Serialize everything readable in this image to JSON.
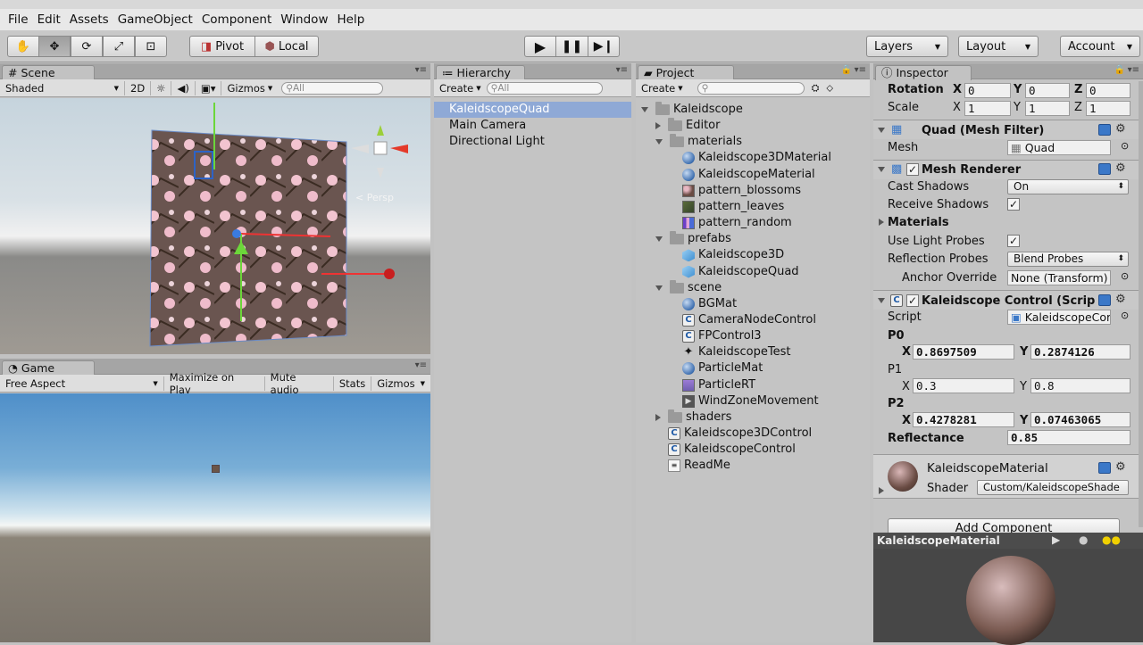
{
  "menu": [
    "File",
    "Edit",
    "Assets",
    "GameObject",
    "Component",
    "Window",
    "Help"
  ],
  "toolbar": {
    "pivot": "Pivot",
    "local": "Local",
    "layers": "Layers",
    "layout": "Layout",
    "account": "Account"
  },
  "scene": {
    "tab": "Scene",
    "shading": "Shaded",
    "mode2d": "2D",
    "gizmos": "Gizmos",
    "search_placeholder": "All",
    "persp": "< Persp"
  },
  "game": {
    "tab": "Game",
    "aspect": "Free Aspect",
    "maximize": "Maximize on Play",
    "mute": "Mute audio",
    "stats": "Stats",
    "gizmos": "Gizmos"
  },
  "hierarchy": {
    "tab": "Hierarchy",
    "create": "Create",
    "search_placeholder": "All",
    "items": [
      "KaleidscopeQuad",
      "Main Camera",
      "Directional Light"
    ]
  },
  "project": {
    "tab": "Project",
    "create": "Create",
    "items": [
      {
        "label": "Kaleidscope",
        "indent": 0,
        "icon": "folder-icon",
        "arrow": "down"
      },
      {
        "label": "Editor",
        "indent": 1,
        "icon": "folder-icon",
        "arrow": "right"
      },
      {
        "label": "materials",
        "indent": 1,
        "icon": "folder-icon",
        "arrow": "down"
      },
      {
        "label": "Kaleidscope3DMaterial",
        "indent": 2,
        "icon": "material-sphere-icon"
      },
      {
        "label": "KaleidscopeMaterial",
        "indent": 2,
        "icon": "material-sphere-icon"
      },
      {
        "label": "pattern_blossoms",
        "indent": 2,
        "icon": "texture-blossoms-icon"
      },
      {
        "label": "pattern_leaves",
        "indent": 2,
        "icon": "texture-leaves-icon"
      },
      {
        "label": "pattern_random",
        "indent": 2,
        "icon": "texture-random-icon"
      },
      {
        "label": "prefabs",
        "indent": 1,
        "icon": "folder-icon",
        "arrow": "down"
      },
      {
        "label": "Kaleidscope3D",
        "indent": 2,
        "icon": "prefab-icon"
      },
      {
        "label": "KaleidscopeQuad",
        "indent": 2,
        "icon": "prefab-icon"
      },
      {
        "label": "scene",
        "indent": 1,
        "icon": "folder-icon",
        "arrow": "down"
      },
      {
        "label": "BGMat",
        "indent": 2,
        "icon": "material-sphere-icon"
      },
      {
        "label": "CameraNodeControl",
        "indent": 2,
        "icon": "script-icon"
      },
      {
        "label": "FPControl3",
        "indent": 2,
        "icon": "script-icon"
      },
      {
        "label": "KaleidscopeTest",
        "indent": 2,
        "icon": "unity-scene-icon"
      },
      {
        "label": "ParticleMat",
        "indent": 2,
        "icon": "material-sphere-icon"
      },
      {
        "label": "ParticleRT",
        "indent": 2,
        "icon": "render-texture-icon"
      },
      {
        "label": "WindZoneMovement",
        "indent": 2,
        "icon": "animation-icon"
      },
      {
        "label": "shaders",
        "indent": 1,
        "icon": "folder-icon",
        "arrow": "right"
      },
      {
        "label": "Kaleidscope3DControl",
        "indent": 1,
        "icon": "script-icon"
      },
      {
        "label": "KaleidscopeControl",
        "indent": 1,
        "icon": "script-icon"
      },
      {
        "label": "ReadMe",
        "indent": 1,
        "icon": "text-file-icon"
      }
    ]
  },
  "inspector": {
    "tab": "Inspector",
    "rotation": {
      "label": "Rotation",
      "x": "0",
      "y": "0",
      "z": "0"
    },
    "scale": {
      "label": "Scale",
      "x": "1",
      "y": "1",
      "z": "1"
    },
    "axis_x": "X",
    "axis_y": "Y",
    "axis_z": "Z",
    "mesh_filter": {
      "title": "Quad (Mesh Filter)",
      "mesh_label": "Mesh",
      "mesh_value": "Quad"
    },
    "mesh_renderer": {
      "title": "Mesh Renderer",
      "cast_shadows_label": "Cast Shadows",
      "cast_shadows_value": "On",
      "receive_shadows_label": "Receive Shadows",
      "materials_label": "Materials",
      "light_probes_label": "Use Light Probes",
      "reflection_label": "Reflection Probes",
      "reflection_value": "Blend Probes",
      "anchor_label": "Anchor Override",
      "anchor_value": "None (Transform)"
    },
    "kcontrol": {
      "title": "Kaleidscope Control (Scrip",
      "script_label": "Script",
      "script_value": "KaleidscopeCor",
      "p0_label": "P0",
      "p0_x": "0.8697509",
      "p0_y": "0.2874126",
      "p1_label": "P1",
      "p1_x": "0.3",
      "p1_y": "0.8",
      "p2_label": "P2",
      "p2_x": "0.4278281",
      "p2_y": "0.07463065",
      "reflectance_label": "Reflectance",
      "reflectance_value": "0.85"
    },
    "material": {
      "name": "KaleidscopeMaterial",
      "shader_label": "Shader",
      "shader_value": "Custom/KaleidscopeShade"
    },
    "add_component": "Add Component",
    "preview_title": "KaleidscopeMaterial"
  }
}
